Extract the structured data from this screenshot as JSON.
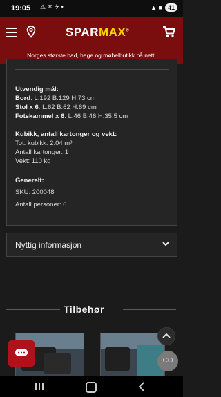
{
  "status_bar": {
    "time": "19:05",
    "left_icons": "⚠ ✉ ✈ •",
    "right_icons": "▲ ■",
    "battery": "41"
  },
  "header": {
    "logo_part1": "SPAR",
    "logo_part2": "MAX",
    "logo_trademark": "®",
    "tagline": "Norges største bad, hage og møbelbutikk på nett!"
  },
  "details": {
    "section1_title": "Utvendig mål:",
    "rows": [
      {
        "label": "Bord",
        "value": ": L:192 B:129 H:73 cm"
      },
      {
        "label": "Stol x 6",
        "value": ": L:62 B:62 H:69 cm"
      },
      {
        "label": "Fotskammel x 6",
        "value": ": L:46 B:46 H:35,5 cm"
      }
    ],
    "section2_title": "Kubikk, antall kartonger og vekt:",
    "volume": "Tot. kubikk: 2.04 m³",
    "cartons": "Antall kartonger: 1",
    "weight": "Vekt: 110 kg",
    "section3_title": "Generelt:",
    "sku": "SKU: 200048",
    "persons": "Antall personer: 6"
  },
  "accordion": {
    "label": "Nyttig informasjon"
  },
  "accessories": {
    "title": "Tilbehør"
  },
  "widgets": {
    "co_label": "CO"
  },
  "colors": {
    "brand_red": "#7a0d0d",
    "logo_yellow": "#f3d300",
    "chat_red": "#b0121c"
  },
  "icons": [
    "menu-icon",
    "location-pin-icon",
    "cart-icon",
    "chevron-down-icon",
    "chevron-up-icon",
    "chat-icon"
  ]
}
